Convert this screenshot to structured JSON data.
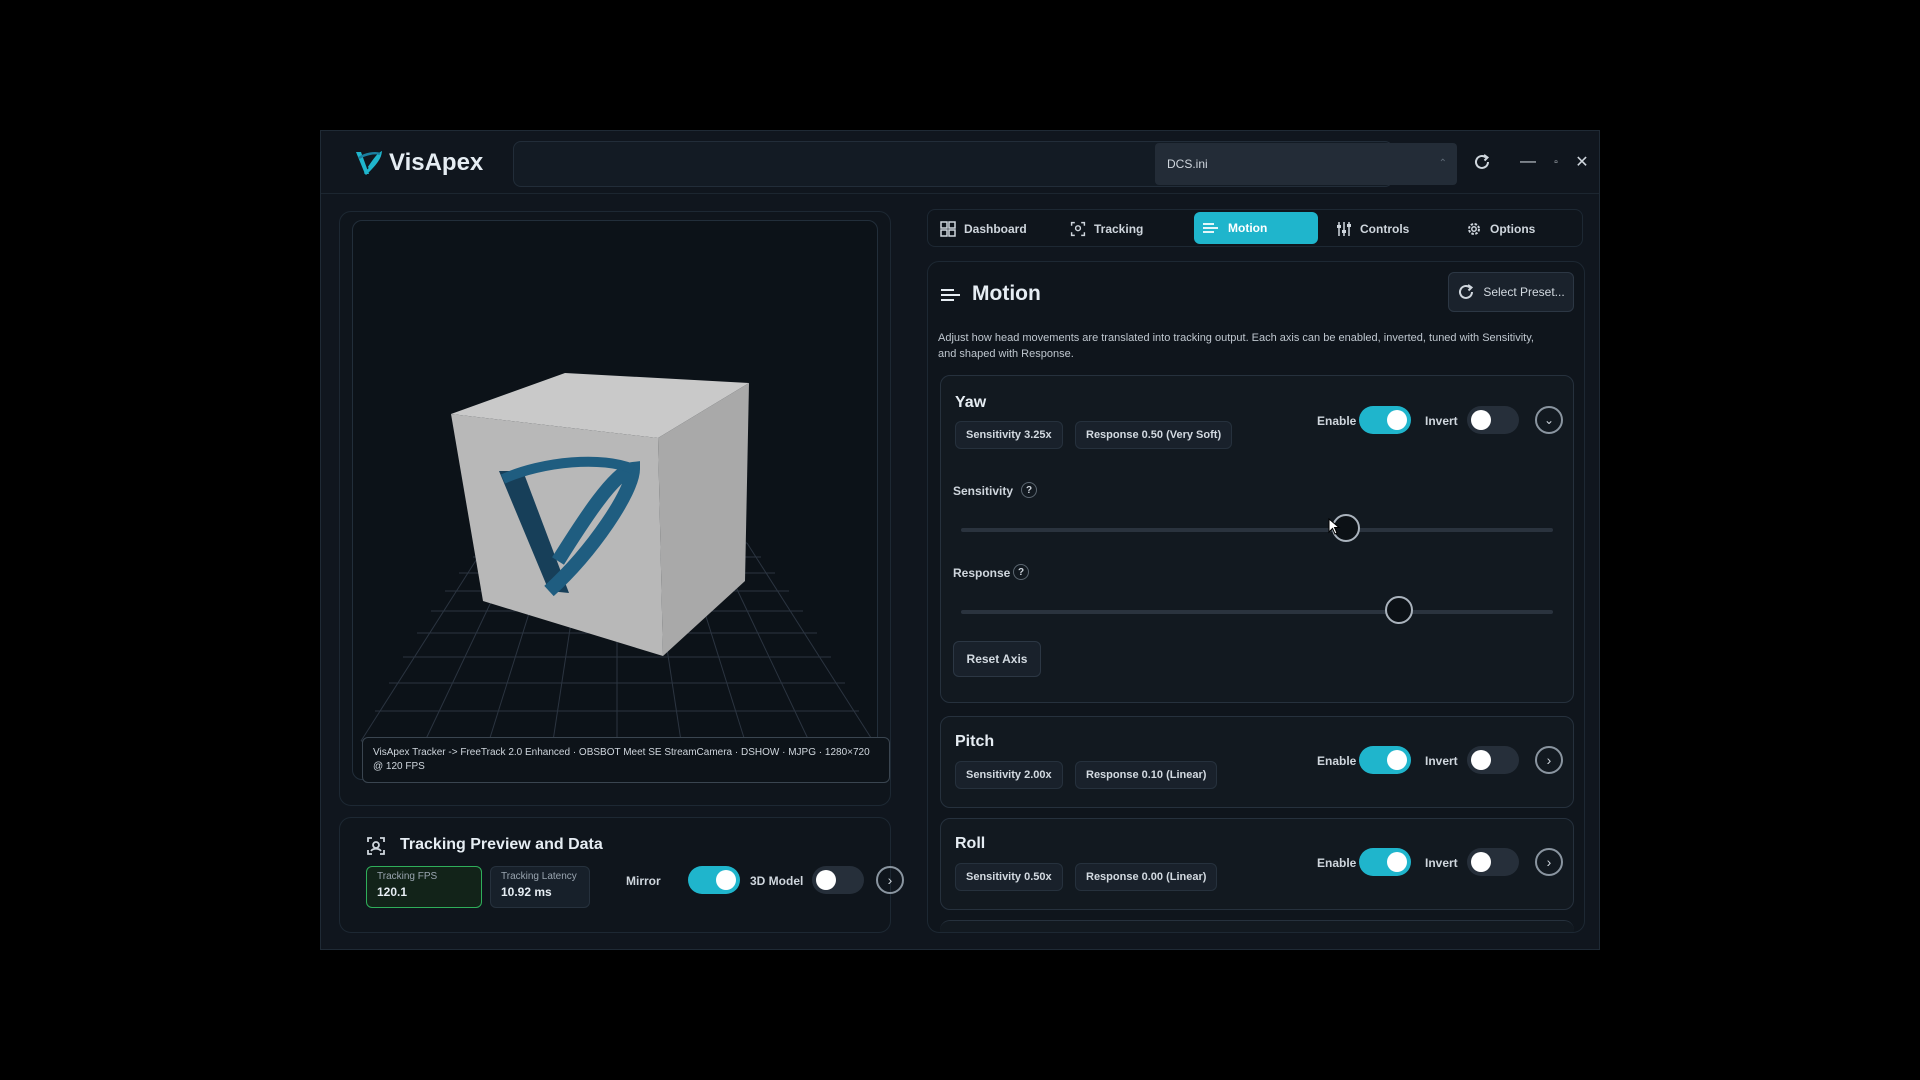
{
  "app": {
    "name": "VisApex"
  },
  "header": {
    "profile_value": "DCS.ini"
  },
  "tabs": [
    {
      "label": "Dashboard",
      "icon": "dashboard-icon"
    },
    {
      "label": "Tracking",
      "icon": "tracking-icon"
    },
    {
      "label": "Motion",
      "icon": "motion-icon",
      "active": true
    },
    {
      "label": "Controls",
      "icon": "sliders-icon"
    },
    {
      "label": "Options",
      "icon": "gear-icon"
    }
  ],
  "preview": {
    "info": "VisApex Tracker -> FreeTrack 2.0 Enhanced · OBSBOT Meet SE StreamCamera · DSHOW · MJPG · 1280×720 @ 120 FPS",
    "panel_title": "Tracking Preview and Data",
    "fps_label": "Tracking FPS",
    "fps_value": "120.1",
    "latency_label": "Tracking Latency",
    "latency_value": "10.92 ms",
    "mirror_label": "Mirror",
    "mirror_on": true,
    "model_label": "3D Model",
    "model_on": false
  },
  "motion": {
    "title": "Motion",
    "preset_label": "Select Preset...",
    "description": "Adjust how head movements are translated into tracking output. Each axis can be enabled, inverted, tuned with Sensitivity, and shaped with Response.",
    "enable_label": "Enable",
    "invert_label": "Invert",
    "sensitivity_label": "Sensitivity",
    "response_label": "Response",
    "reset_label": "Reset Axis",
    "axes": [
      {
        "name": "Yaw",
        "sensitivity_chip": "Sensitivity 3.25x",
        "response_chip": "Response 0.50 (Very Soft)",
        "enabled": true,
        "inverted": false,
        "expanded": true,
        "sensitivity_fraction": 0.65,
        "response_fraction": 0.74
      },
      {
        "name": "Pitch",
        "sensitivity_chip": "Sensitivity 2.00x",
        "response_chip": "Response 0.10 (Linear)",
        "enabled": true,
        "inverted": false,
        "expanded": false
      },
      {
        "name": "Roll",
        "sensitivity_chip": "Sensitivity 0.50x",
        "response_chip": "Response 0.00 (Linear)",
        "enabled": true,
        "inverted": false,
        "expanded": false
      }
    ]
  },
  "colors": {
    "accent": "#1fb5cc",
    "background": "#10161e",
    "fps_border": "#2fae5a"
  }
}
